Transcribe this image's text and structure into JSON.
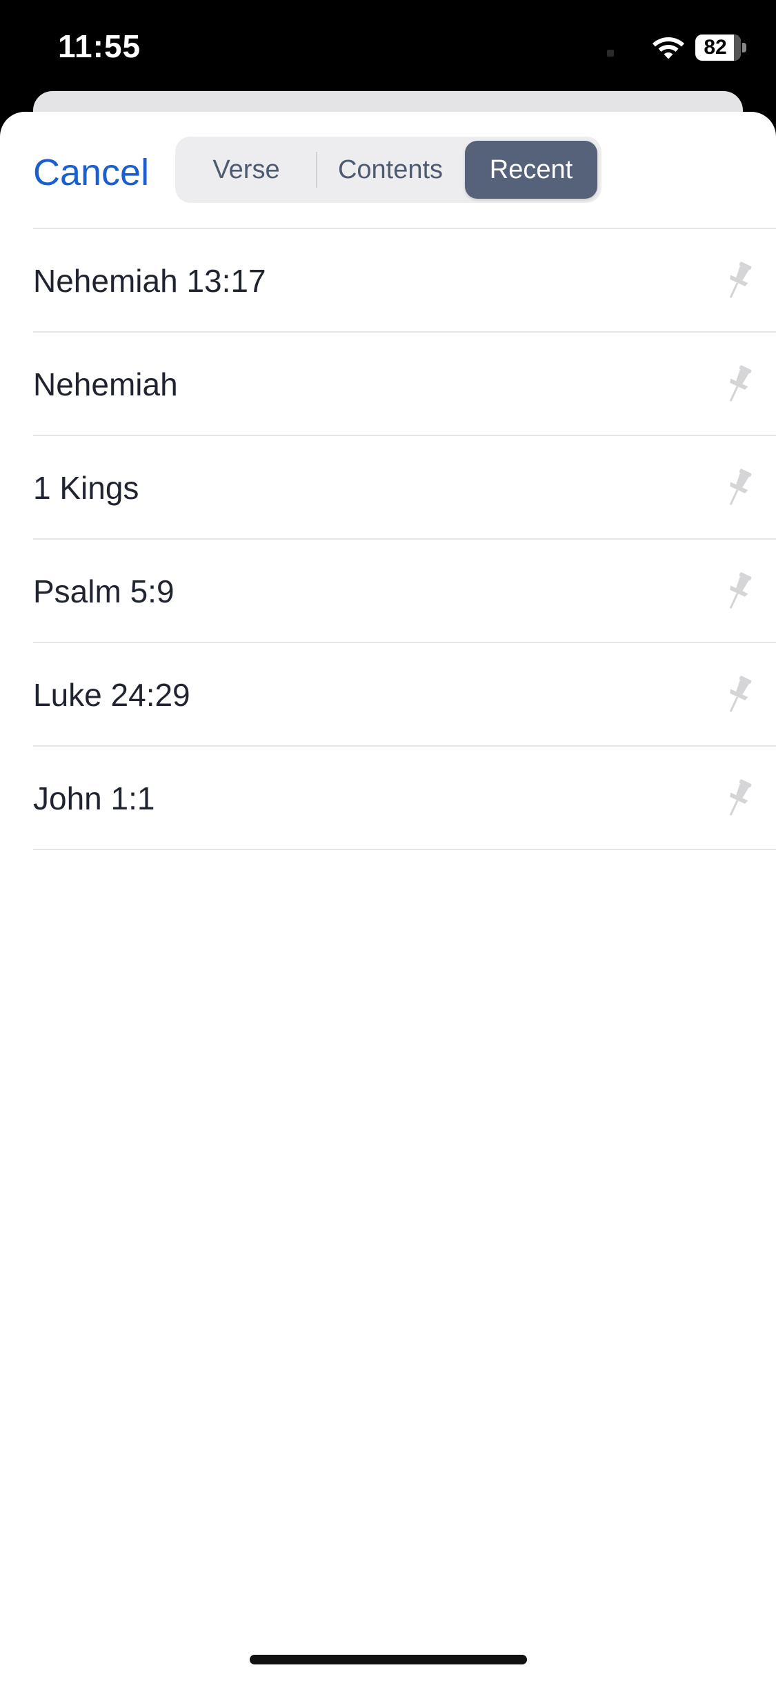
{
  "status_bar": {
    "time": "11:55",
    "battery_level": "82",
    "wifi_icon": "wifi-icon",
    "battery_icon": "battery-icon"
  },
  "header": {
    "cancel_label": "Cancel",
    "tabs": [
      {
        "label": "Verse",
        "selected": false
      },
      {
        "label": "Contents",
        "selected": false
      },
      {
        "label": "Recent",
        "selected": true
      }
    ]
  },
  "recent": {
    "items": [
      {
        "label": "Nehemiah 13:17",
        "icon": "pin-icon"
      },
      {
        "label": "Nehemiah",
        "icon": "pin-icon"
      },
      {
        "label": "1 Kings",
        "icon": "pin-icon"
      },
      {
        "label": "Psalm 5:9",
        "icon": "pin-icon"
      },
      {
        "label": "Luke 24:29",
        "icon": "pin-icon"
      },
      {
        "label": "John 1:1",
        "icon": "pin-icon"
      }
    ]
  },
  "colors": {
    "accent": "#1a5fd0",
    "selected_tab": "#55627a",
    "pin_icon": "#d5d5d8"
  }
}
